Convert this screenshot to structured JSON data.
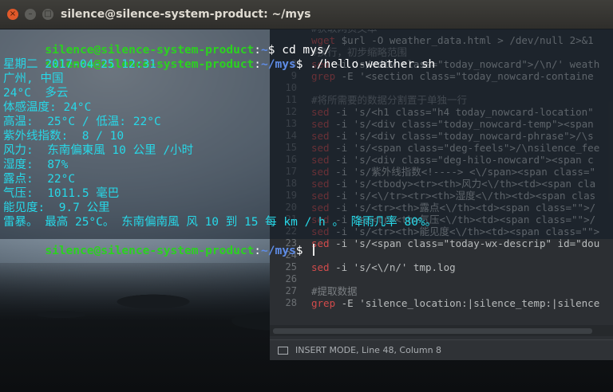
{
  "terminal": {
    "title": "silence@silence-system-product: ~/mys",
    "window_buttons": {
      "close": "×",
      "minimize": "–",
      "maximize": "□"
    },
    "user_host": "silence@silence-system-product",
    "lines": [
      {
        "path": "~",
        "command": "cd mys/"
      },
      {
        "path": "~/mys",
        "command": "./hello-weather.sh"
      }
    ],
    "output": [
      "星期二 2017-04-25 12:31",
      "广州, 中国",
      "24°C  多云",
      "体感温度: 24°C",
      "高温:  25°C / 低温: 22°C",
      "紫外线指数:  8 / 10",
      "风力:  东南偏東風 10 公里 /小时",
      "湿度:  87%",
      "露点:  22°C",
      "气压:  1011.5 毫巴",
      "能见度:  9.7 公里",
      "雷暴。 最高 25°C。 东南偏南風 风 10 到 15 每 km / h 。 降雨几率 80%。"
    ],
    "final_prompt_path": "~/mys"
  },
  "editor": {
    "lines": [
      {
        "num": "",
        "parts": [
          {
            "c": "c-cmt",
            "t": "#获取网页文本"
          }
        ]
      },
      {
        "num": "",
        "parts": [
          {
            "c": "c-cmd",
            "t": "wget"
          },
          {
            "c": "c-str",
            "t": " $url -O weather_data.html > /dev/null 2>&1"
          }
        ]
      },
      {
        "num": "",
        "parts": [
          {
            "c": "c-cmt",
            "t": "#换行，初步缩略范围"
          }
        ]
      },
      {
        "num": "8",
        "parts": [
          {
            "c": "c-cmd",
            "t": "sed"
          },
          {
            "c": "c-str",
            "t": " -i 's/<div class=\"today_nowcard\">/\\n/' weath"
          }
        ]
      },
      {
        "num": "9",
        "parts": [
          {
            "c": "c-grep",
            "t": "grep"
          },
          {
            "c": "c-str",
            "t": " -E '<section class=\"today_nowcard-containe"
          }
        ]
      },
      {
        "num": "10",
        "parts": []
      },
      {
        "num": "11",
        "parts": [
          {
            "c": "c-cmt",
            "t": "#将所需要的数据分割置于单独一行"
          }
        ]
      },
      {
        "num": "12",
        "parts": [
          {
            "c": "c-cmd",
            "t": "sed"
          },
          {
            "c": "c-str",
            "t": " -i 's/<h1 class=\"h4 today_nowcard-location\""
          }
        ]
      },
      {
        "num": "13",
        "parts": [
          {
            "c": "c-cmd",
            "t": "sed"
          },
          {
            "c": "c-str",
            "t": " -i 's/<div class=\"today_nowcard-temp\"><span"
          }
        ]
      },
      {
        "num": "14",
        "parts": [
          {
            "c": "c-cmd",
            "t": "sed"
          },
          {
            "c": "c-str",
            "t": " -i 's/<div class=\"today_nowcard-phrase\">/\\s"
          }
        ]
      },
      {
        "num": "15",
        "parts": [
          {
            "c": "c-cmd",
            "t": "sed"
          },
          {
            "c": "c-str",
            "t": " -i 's/<span class=\"deg-feels\">/\\nsilence_fee"
          }
        ]
      },
      {
        "num": "16",
        "parts": [
          {
            "c": "c-cmd",
            "t": "sed"
          },
          {
            "c": "c-str",
            "t": " -i 's/<div class=\"deg-hilo-nowcard\"><span c"
          }
        ]
      },
      {
        "num": "17",
        "parts": [
          {
            "c": "c-cmd",
            "t": "sed"
          },
          {
            "c": "c-str",
            "t": " -i 's/紫外线指数<!----> <\\/span><span class=\""
          }
        ]
      },
      {
        "num": "18",
        "parts": [
          {
            "c": "c-cmd",
            "t": "sed"
          },
          {
            "c": "c-str",
            "t": " -i 's/<tbody><tr><th>风力<\\/th><td><span cla"
          }
        ]
      },
      {
        "num": "19",
        "parts": [
          {
            "c": "c-cmd",
            "t": "sed"
          },
          {
            "c": "c-str",
            "t": " -i 's/<\\/tr><tr><th>湿度<\\/th><td><span clas"
          }
        ]
      },
      {
        "num": "20",
        "parts": [
          {
            "c": "c-cmd",
            "t": "sed"
          },
          {
            "c": "c-str",
            "t": " -i 's/<tr><th>露点<\\/th><td><span class=\"\">/"
          }
        ]
      },
      {
        "num": "21",
        "parts": [
          {
            "c": "c-cmd",
            "t": "sed"
          },
          {
            "c": "c-str",
            "t": " -i 's/<tr><th>气压<\\/th><td><span class=\"\">/"
          }
        ]
      },
      {
        "num": "22",
        "parts": [
          {
            "c": "c-cmd",
            "t": "sed"
          },
          {
            "c": "c-str",
            "t": " -i 's/<tr><th>能见度<\\/th><td><span class=\"\">"
          }
        ]
      },
      {
        "num": "23",
        "parts": [
          {
            "c": "c-cmd",
            "t": "sed"
          },
          {
            "c": "c-str",
            "t": " -i 's/<span class=\"today-wx-descrip\" id=\"dou"
          }
        ]
      },
      {
        "num": "24",
        "parts": []
      },
      {
        "num": "25",
        "parts": [
          {
            "c": "c-cmd",
            "t": "sed"
          },
          {
            "c": "c-str",
            "t": " -i 's/<\\/n/' tmp.log"
          }
        ]
      },
      {
        "num": "26",
        "parts": []
      },
      {
        "num": "27",
        "parts": [
          {
            "c": "c-cmt",
            "t": "#提取数据"
          }
        ]
      },
      {
        "num": "28",
        "parts": [
          {
            "c": "c-grep",
            "t": "grep"
          },
          {
            "c": "c-str",
            "t": " -E 'silence_location:|silence_temp:|silence"
          }
        ]
      }
    ],
    "status": "INSERT MODE, Line 48, Column 8"
  }
}
